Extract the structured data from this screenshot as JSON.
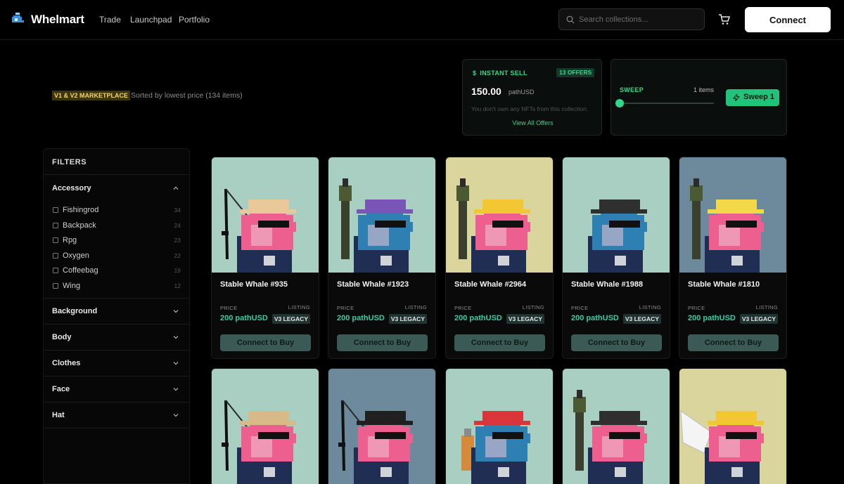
{
  "header": {
    "brand": "Whelmart",
    "nav": [
      "Trade",
      "Launchpad",
      "Portfolio"
    ],
    "search_placeholder": "Search collections...",
    "connect_label": "Connect"
  },
  "subheader": {
    "market_badge": "V1 & V2 MARKETPLACE",
    "sorted_text": "Sorted by lowest price (134 items)"
  },
  "instant_sell": {
    "title": "INSTANT SELL",
    "offers_badge": "13 OFFERS",
    "price": "150.00",
    "unit": "pathUSD",
    "note": "You don't own any NFTs from this collection.",
    "link": "View All Offers"
  },
  "sweep": {
    "title": "SWEEP",
    "items_text": "1 items",
    "button_label": "Sweep 1",
    "slider_value": 1
  },
  "filters": {
    "title": "FILTERS",
    "sections": [
      "Accessory",
      "Background",
      "Body",
      "Clothes",
      "Face",
      "Hat"
    ],
    "accessory_options": [
      {
        "label": "Fishingrod",
        "count": "34"
      },
      {
        "label": "Backpack",
        "count": "24"
      },
      {
        "label": "Rpg",
        "count": "23"
      },
      {
        "label": "Oxygen",
        "count": "22"
      },
      {
        "label": "Coffeebag",
        "count": "19"
      },
      {
        "label": "Wing",
        "count": "12"
      }
    ]
  },
  "card_labels": {
    "price": "PRICE",
    "listing": "LISTING",
    "buy": "Connect to Buy"
  },
  "cards": [
    {
      "name": "Stable Whale #935",
      "price": "200 pathUSD",
      "listing": "V3 LEGACY",
      "bg": "#a8cfc2",
      "body": "#ec5f8e",
      "hat": "#e9c99a",
      "accessory": "fishingrod"
    },
    {
      "name": "Stable Whale #1923",
      "price": "200 pathUSD",
      "listing": "V3 LEGACY",
      "bg": "#a8cfc2",
      "body": "#2e7fb2",
      "hat": "#7a55b8",
      "accessory": "rpg"
    },
    {
      "name": "Stable Whale #2964",
      "price": "200 pathUSD",
      "listing": "V3 LEGACY",
      "bg": "#d9d59c",
      "body": "#ec5f8e",
      "hat": "#f3c634",
      "accessory": "rpg"
    },
    {
      "name": "Stable Whale #1988",
      "price": "200 pathUSD",
      "listing": "V3 LEGACY",
      "bg": "#a8cfc2",
      "body": "#2e7fb2",
      "hat": "#2f2f2f",
      "accessory": "none"
    },
    {
      "name": "Stable Whale #1810",
      "price": "200 pathUSD",
      "listing": "V3 LEGACY",
      "bg": "#6d8a9c",
      "body": "#ec5f8e",
      "hat": "#f3d84a",
      "accessory": "rpg"
    },
    {
      "name": "",
      "bg": "#a8cfc2",
      "body": "#ec5f8e",
      "hat": "#d8b98a",
      "accessory": "fishingrod"
    },
    {
      "name": "",
      "bg": "#6d8a9c",
      "body": "#ec5f8e",
      "hat": "#202020",
      "accessory": "fishingrod"
    },
    {
      "name": "",
      "bg": "#a8cfc2",
      "body": "#2e7fb2",
      "hat": "#d9353a",
      "accessory": "oxygen"
    },
    {
      "name": "",
      "bg": "#a8cfc2",
      "body": "#ec5f8e",
      "hat": "#2f2f2f",
      "accessory": "rpg"
    },
    {
      "name": "",
      "bg": "#d9d59c",
      "body": "#ec5f8e",
      "hat": "#f3c634",
      "accessory": "wing"
    }
  ]
}
